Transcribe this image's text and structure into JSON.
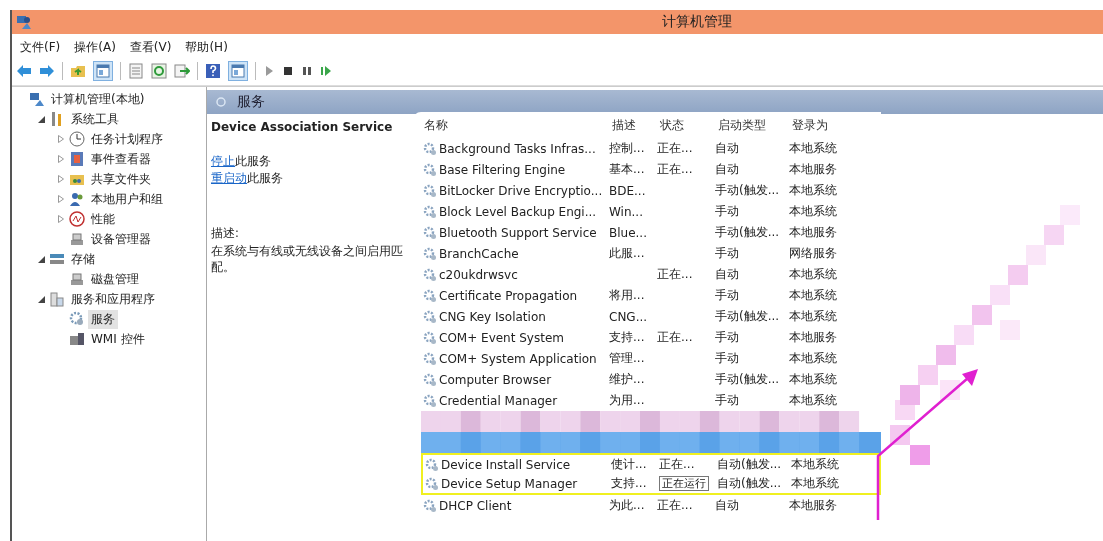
{
  "window": {
    "title": "计算机管理"
  },
  "menu": [
    "文件(F)",
    "操作(A)",
    "查看(V)",
    "帮助(H)"
  ],
  "tree": [
    {
      "label": "计算机管理(本地)",
      "selected": false,
      "children": [
        {
          "label": "系统工具",
          "expanded": true,
          "selected": false,
          "children": [
            {
              "label": "任务计划程序",
              "expanded": false,
              "selected": false
            },
            {
              "label": "事件查看器",
              "expanded": false,
              "selected": false
            },
            {
              "label": "共享文件夹",
              "expanded": false,
              "selected": false
            },
            {
              "label": "本地用户和组",
              "expanded": false,
              "selected": false
            },
            {
              "label": "性能",
              "expanded": false,
              "selected": false
            },
            {
              "label": "设备管理器",
              "selected": false
            }
          ]
        },
        {
          "label": "存储",
          "expanded": true,
          "selected": false,
          "children": [
            {
              "label": "磁盘管理",
              "selected": false
            }
          ]
        },
        {
          "label": "服务和应用程序",
          "expanded": true,
          "selected": false,
          "children": [
            {
              "label": "服务",
              "selected": true
            },
            {
              "label": "WMI 控件",
              "selected": false
            }
          ]
        }
      ]
    }
  ],
  "panel": {
    "title": "服务"
  },
  "detail": {
    "service_name": "Device Association Service",
    "actions": [
      {
        "link": "停止",
        "text": "此服务"
      },
      {
        "link": "重启动",
        "text": "此服务"
      }
    ],
    "description_label": "描述:",
    "description": "在系统与有线或无线设备之间启用匹配。"
  },
  "table": {
    "columns": [
      "名称",
      "描述",
      "状态",
      "启动类型",
      "登录为"
    ],
    "rows": [
      {
        "kind": "service",
        "name": "Background Tasks Infras...",
        "description": "控制...",
        "status": "正在...",
        "startup": "自动",
        "logon": "本地系统",
        "selected": false,
        "highlighted": false
      },
      {
        "kind": "service",
        "name": "Base Filtering Engine",
        "description": "基本...",
        "status": "正在...",
        "startup": "自动",
        "logon": "本地服务",
        "selected": false,
        "highlighted": false
      },
      {
        "kind": "service",
        "name": "BitLocker Drive Encryptio...",
        "description": "BDE...",
        "startup": "手动(触发...",
        "logon": "本地系统",
        "selected": false,
        "highlighted": false
      },
      {
        "kind": "service",
        "name": "Block Level Backup Engi...",
        "description": "Win...",
        "startup": "手动",
        "logon": "本地系统",
        "selected": false,
        "highlighted": false
      },
      {
        "kind": "service",
        "name": "Bluetooth Support Service",
        "description": "Blue...",
        "startup": "手动(触发...",
        "logon": "本地服务",
        "selected": false,
        "highlighted": false
      },
      {
        "kind": "service",
        "name": "BranchCache",
        "description": "此服...",
        "startup": "手动",
        "logon": "网络服务",
        "selected": false,
        "highlighted": false
      },
      {
        "kind": "service",
        "name": "c20ukdrwsvc",
        "status": "正在...",
        "startup": "自动",
        "logon": "本地系统",
        "selected": false,
        "highlighted": false
      },
      {
        "kind": "service",
        "name": "Certificate Propagation",
        "description": "将用...",
        "startup": "手动",
        "logon": "本地系统",
        "selected": false,
        "highlighted": false
      },
      {
        "kind": "service",
        "name": "CNG Key Isolation",
        "description": "CNG...",
        "startup": "手动(触发...",
        "logon": "本地系统",
        "selected": false,
        "highlighted": false
      },
      {
        "kind": "service",
        "name": "COM+ Event System",
        "description": "支持...",
        "status": "正在...",
        "startup": "手动",
        "logon": "本地服务",
        "selected": false,
        "highlighted": false
      },
      {
        "kind": "service",
        "name": "COM+ System Application",
        "description": "管理...",
        "startup": "手动",
        "logon": "本地系统",
        "selected": false,
        "highlighted": false
      },
      {
        "kind": "service",
        "name": "Computer Browser",
        "description": "维护...",
        "startup": "手动(触发...",
        "logon": "本地系统",
        "selected": false,
        "highlighted": false
      },
      {
        "kind": "service",
        "name": "Credential Manager",
        "description": "为用...",
        "startup": "手动",
        "logon": "本地系统",
        "selected": false,
        "highlighted": false
      },
      {
        "kind": "blurred",
        "selected": false,
        "highlighted": false
      },
      {
        "kind": "blurred",
        "selected": true,
        "highlighted": false
      },
      {
        "kind": "service",
        "name": "Device Install Service",
        "description": "使计...",
        "status": "正在...",
        "startup": "自动(触发...",
        "logon": "本地系统",
        "selected": false,
        "highlighted": true
      },
      {
        "kind": "service",
        "name": "Device Setup Manager",
        "description": "支持...",
        "tooltip": "正在运行",
        "startup": "自动(触发...",
        "logon": "本地系统",
        "selected": false,
        "highlighted": true
      },
      {
        "kind": "service",
        "name": "DHCP Client",
        "description": "为此...",
        "status": "正在...",
        "startup": "自动",
        "logon": "本地服务",
        "selected": false,
        "highlighted": false
      }
    ]
  }
}
